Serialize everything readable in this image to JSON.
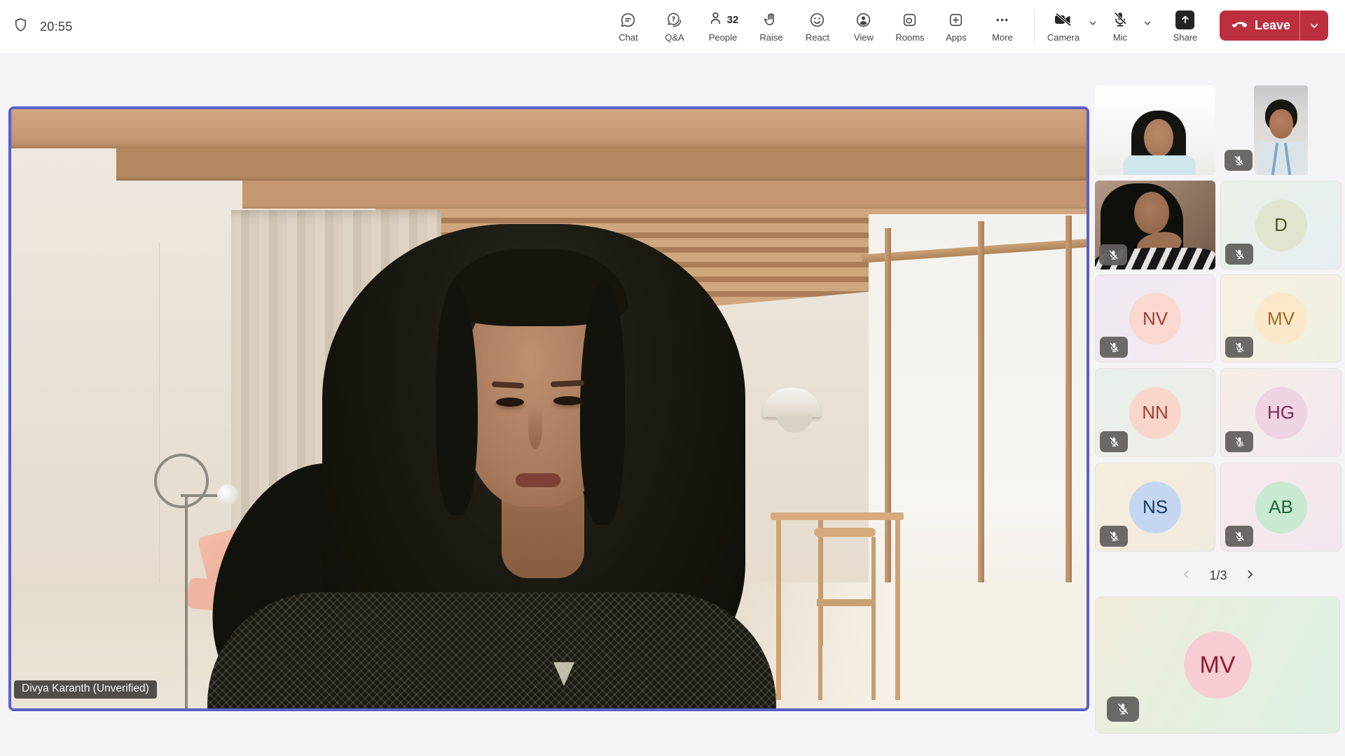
{
  "colors": {
    "accent": "#5b5fc7",
    "leave_button": "#bc2f3e"
  },
  "header": {
    "timer": "20:55",
    "items": [
      {
        "label": "Chat"
      },
      {
        "label": "Q&A"
      },
      {
        "label": "People",
        "badge": "32"
      },
      {
        "label": "Raise"
      },
      {
        "label": "React"
      },
      {
        "label": "View"
      },
      {
        "label": "Rooms"
      },
      {
        "label": "Apps"
      },
      {
        "label": "More"
      }
    ],
    "camera_label": "Camera",
    "mic_label": "Mic",
    "share_label": "Share",
    "leave_label": "Leave"
  },
  "stage": {
    "speaker_name": "Divya Karanth (Unverified)"
  },
  "sidebar": {
    "pagination": "1/3",
    "grid": [
      {
        "type": "video",
        "muted": false
      },
      {
        "type": "video-portrait",
        "muted": true
      },
      {
        "type": "video",
        "muted": true
      },
      {
        "type": "avatar",
        "initials": "D",
        "muted": true,
        "circle": "#dfe5cf",
        "text_color": "#4a5420"
      },
      {
        "type": "avatar",
        "initials": "NV",
        "muted": true,
        "circle": "#f9d8cf",
        "text_color": "#a63d2e"
      },
      {
        "type": "avatar",
        "initials": "MV",
        "muted": true,
        "circle": "#fbe8c9",
        "text_color": "#9a6a1d"
      },
      {
        "type": "avatar",
        "initials": "NN",
        "muted": true,
        "circle": "#f9d6cc",
        "text_color": "#a33d2c"
      },
      {
        "type": "avatar",
        "initials": "HG",
        "muted": true,
        "circle": "#eed3e3",
        "text_color": "#7d2c56"
      },
      {
        "type": "avatar",
        "initials": "NS",
        "muted": true,
        "circle": "#c5d7f0",
        "text_color": "#123a66"
      },
      {
        "type": "avatar",
        "initials": "AB",
        "muted": true,
        "circle": "#c8e9d2",
        "text_color": "#1d6637"
      }
    ],
    "bottom_tile": {
      "initials": "MV",
      "muted": true,
      "circle": "#f7ccd2",
      "text_color": "#8c1f2f"
    }
  }
}
